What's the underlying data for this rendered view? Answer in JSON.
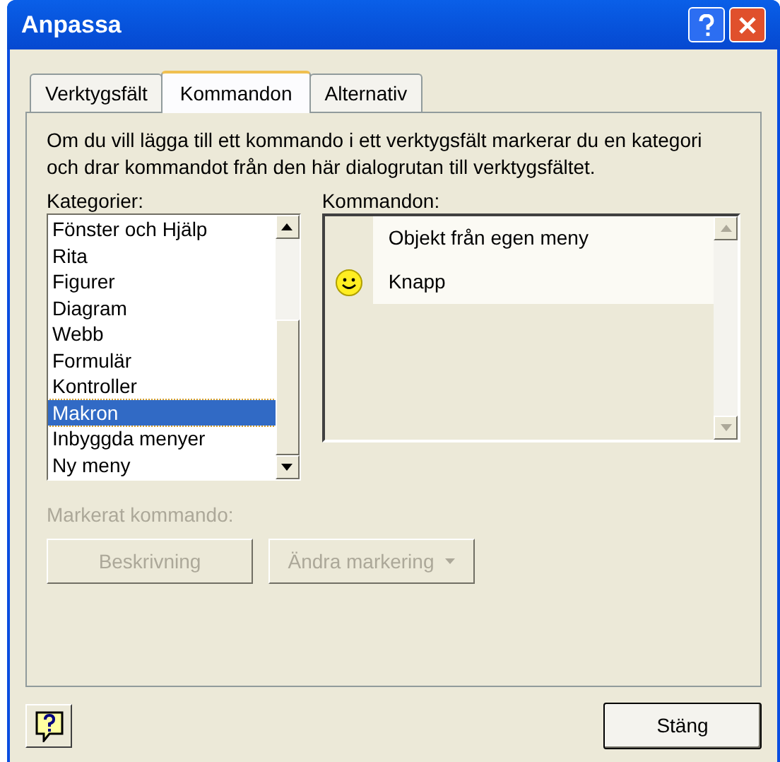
{
  "window": {
    "title": "Anpassa"
  },
  "tabs": [
    {
      "label": "Verktygsfält",
      "selected": false
    },
    {
      "label": "Kommandon",
      "selected": true
    },
    {
      "label": "Alternativ",
      "selected": false
    }
  ],
  "description": "Om du vill lägga till ett kommando i ett verktygsfält markerar du en kategori och drar kommandot från den här dialogrutan till verktygsfältet.",
  "categories": {
    "label": "Kategorier:",
    "items": [
      {
        "label": "Fönster och Hjälp",
        "selected": false
      },
      {
        "label": "Rita",
        "selected": false
      },
      {
        "label": "Figurer",
        "selected": false
      },
      {
        "label": "Diagram",
        "selected": false
      },
      {
        "label": "Webb",
        "selected": false
      },
      {
        "label": "Formulär",
        "selected": false
      },
      {
        "label": "Kontroller",
        "selected": false
      },
      {
        "label": "Makron",
        "selected": true
      },
      {
        "label": "Inbyggda menyer",
        "selected": false
      },
      {
        "label": "Ny meny",
        "selected": false
      }
    ]
  },
  "commands": {
    "label": "Kommandon:",
    "items": [
      {
        "label": "Objekt från egen meny",
        "kind": "plain"
      },
      {
        "label": "Knapp",
        "kind": "smiley"
      }
    ]
  },
  "selected_command": {
    "label": "Markerat kommando:",
    "disabled": true,
    "buttons": [
      {
        "label": "Beskrivning",
        "kind": "plain"
      },
      {
        "label": "Ändra markering",
        "kind": "dropdown"
      }
    ]
  },
  "close_button": "Stäng"
}
